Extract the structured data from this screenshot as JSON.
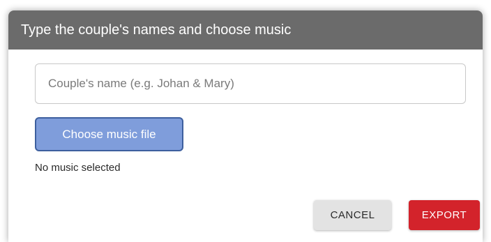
{
  "dialog": {
    "title": "Type the couple's names and choose music",
    "name_input": {
      "value": "",
      "placeholder": "Couple's name (e.g. Johan & Mary)"
    },
    "music_button_label": "Choose music file",
    "music_status": "No music selected",
    "cancel_label": "CANCEL",
    "export_label": "EXPORT"
  },
  "colors": {
    "header_bg": "#6b6b6b",
    "music_button_bg": "#7f9ddb",
    "music_button_border": "#3d5f9e",
    "cancel_bg": "#e3e3e3",
    "export_bg": "#d3232b"
  }
}
